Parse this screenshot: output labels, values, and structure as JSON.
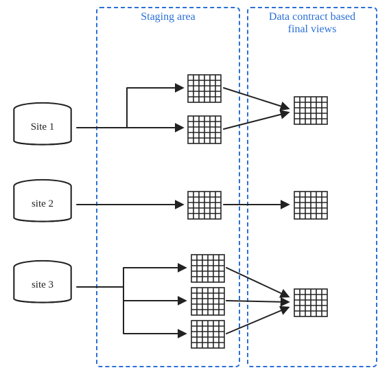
{
  "zones": {
    "staging": {
      "title": "Staging area"
    },
    "final": {
      "title": "Data contract based\nfinal views"
    }
  },
  "sources": {
    "site1": {
      "label": "Site 1"
    },
    "site2": {
      "label": "site 2"
    },
    "site3": {
      "label": "site 3"
    }
  },
  "diagram": {
    "type": "data-flow",
    "description": "Three source data stores (sites) feed a staging area producing intermediate tables, which are then transformed into data-contract-based final views.",
    "flows": [
      {
        "source": "Site 1",
        "staging_tables": 2,
        "final_views": 1
      },
      {
        "source": "site 2",
        "staging_tables": 1,
        "final_views": 1
      },
      {
        "source": "site 3",
        "staging_tables": 3,
        "final_views": 1
      }
    ]
  }
}
